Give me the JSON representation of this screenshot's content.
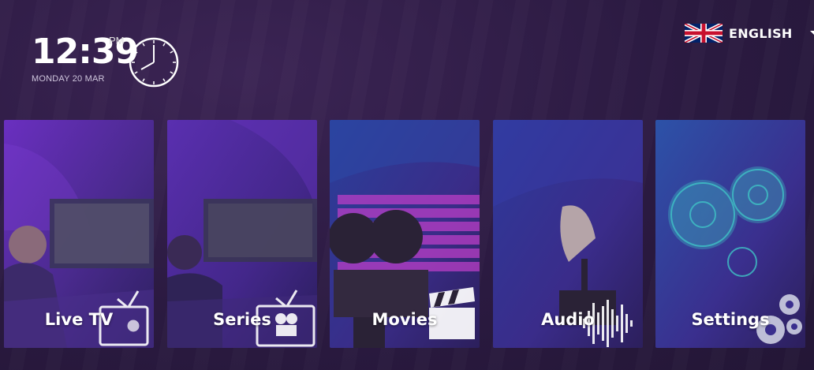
{
  "clock": {
    "time": "12:39",
    "ampm": "PM",
    "date": "MONDAY 20 MAR"
  },
  "language": {
    "label": "ENGLISH",
    "flag": "uk-flag-icon"
  },
  "tiles": [
    {
      "label": "Live TV",
      "icon": "tv-play-icon"
    },
    {
      "label": "Series",
      "icon": "tv-film-reel-icon"
    },
    {
      "label": "Movies",
      "icon": "clapperboard-icon"
    },
    {
      "label": "Audio",
      "icon": "sound-wave-icon"
    },
    {
      "label": "Settings",
      "icon": "gears-icon"
    }
  ],
  "colors": {
    "background": "#2b1a41",
    "tile_purple": "#5a2fa0",
    "tile_blue": "#2a3f8f",
    "accent_magenta": "#b93ec6"
  }
}
